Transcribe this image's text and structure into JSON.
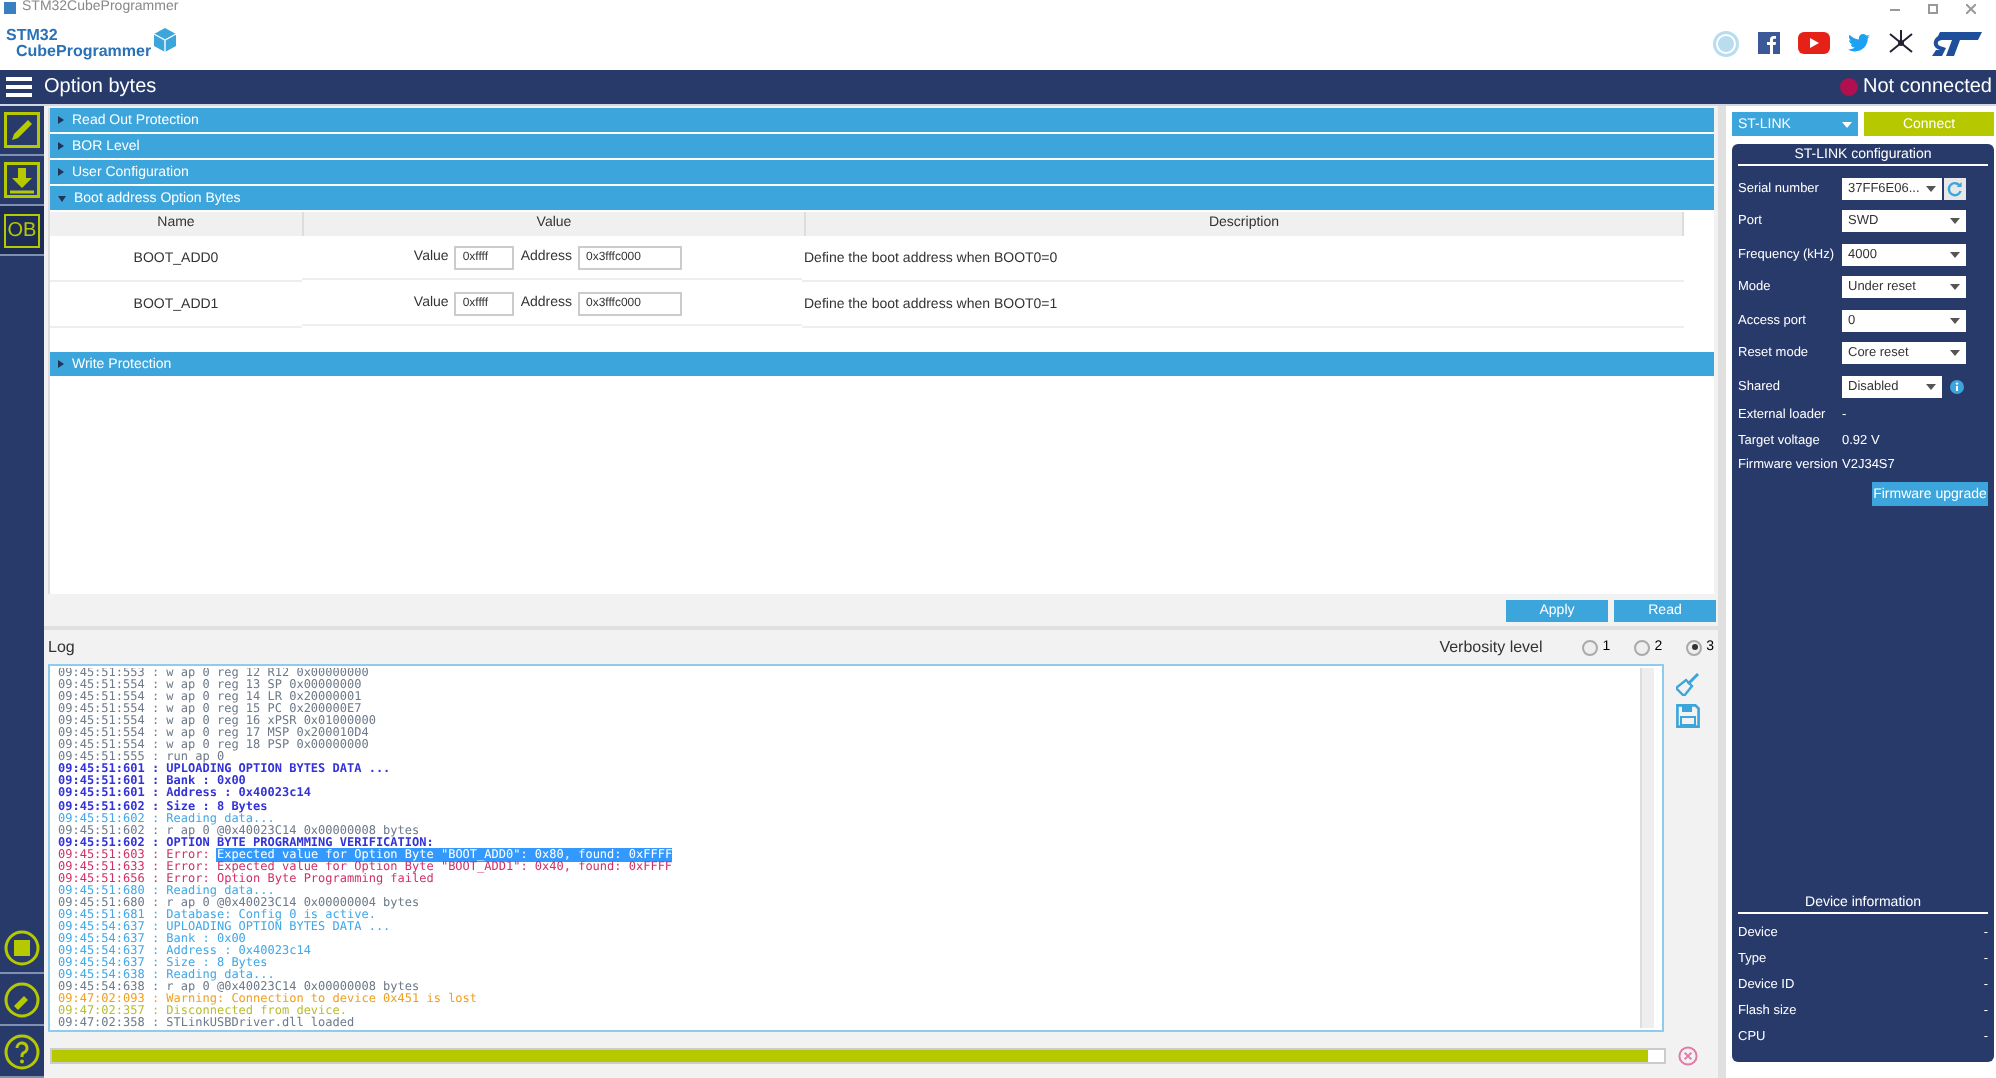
{
  "window": {
    "title": "STM32CubeProgrammer"
  },
  "logo": {
    "line_1": "STM32",
    "line_2": "CubeProgrammer"
  },
  "page_title": "Option bytes",
  "connection_status": {
    "text": "Not connected",
    "connected": false
  },
  "sidebar": {
    "items": [
      {
        "kind": "pencil",
        "selected": false
      },
      {
        "kind": "download",
        "selected": false
      },
      {
        "kind": "text",
        "label": "OB",
        "selected": true
      }
    ],
    "bottom_items": [
      {
        "kind": "chip"
      },
      {
        "kind": "plug"
      },
      {
        "kind": "help"
      }
    ]
  },
  "sections": [
    {
      "title": "Read Out Protection",
      "expanded": false
    },
    {
      "title": "BOR Level",
      "expanded": false
    },
    {
      "title": "User Configuration",
      "expanded": false
    },
    {
      "title": "Boot address Option Bytes",
      "expanded": true,
      "table": {
        "columns": [
          "Name",
          "Value",
          "Description"
        ],
        "rows": [
          {
            "name": "BOOT_ADD0",
            "value_label": "Value",
            "value": "0xffff",
            "address_label": "Address",
            "address": "0x3fffc000",
            "description": "Define the boot address when BOOT0=0"
          },
          {
            "name": "BOOT_ADD1",
            "value_label": "Value",
            "value": "0xffff",
            "address_label": "Address",
            "address": "0x3fffc000",
            "description": "Define the boot address when BOOT0=1"
          }
        ]
      }
    },
    {
      "title": "Write Protection",
      "expanded": false
    }
  ],
  "buttons": [
    "Apply",
    "Read"
  ],
  "log": {
    "title": "Log",
    "verbosity_label": "Verbosity level",
    "verbosity": [
      {
        "label": "1",
        "selected": false
      },
      {
        "label": "2",
        "selected": false
      },
      {
        "label": "3",
        "selected": true
      }
    ],
    "lines": [
      {
        "text": "09:45:51:553 : w ap 0 reg 12 R12 0x00000000",
        "kind": "normal"
      },
      {
        "text": "09:45:51:554 : w ap 0 reg 13 SP 0x00000000",
        "kind": "normal"
      },
      {
        "text": "09:45:51:554 : w ap 0 reg 14 LR 0x20000001",
        "kind": "normal"
      },
      {
        "text": "09:45:51:554 : w ap 0 reg 15 PC 0x200000E7",
        "kind": "normal"
      },
      {
        "text": "09:45:51:554 : w ap 0 reg 16 xPSR 0x01000000",
        "kind": "normal"
      },
      {
        "text": "09:45:51:554 : w ap 0 reg 17 MSP 0x200010D4",
        "kind": "normal"
      },
      {
        "text": "09:45:51:554 : w ap 0 reg 18 PSP 0x00000000",
        "kind": "normal"
      },
      {
        "text": "09:45:51:555 : run ap 0",
        "kind": "normal"
      },
      {
        "text": "09:45:51:601 : UPLOADING OPTION BYTES DATA ...",
        "kind": "title"
      },
      {
        "text": "09:45:51:601 : Bank : 0x00",
        "kind": "title"
      },
      {
        "text": "09:45:51:601 : Address : 0x40023c14",
        "kind": "title"
      },
      {
        "text": "09:45:51:602 : Size : 8 Bytes",
        "kind": "title"
      },
      {
        "text": "09:45:51:602 : Reading data...",
        "kind": "info"
      },
      {
        "text": "09:45:51:602 : r ap 0 @0x40023C14 0x00000008 bytes",
        "kind": "normal"
      },
      {
        "text": "09:45:51:602 : OPTION BYTE PROGRAMMING VERIFICATION:",
        "kind": "title"
      },
      {
        "text": "09:45:51:603 : Error: ",
        "selected_text": "Expected value for Option Byte \"BOOT_ADD0\": 0x80, found: 0xFFFF",
        "kind": "error"
      },
      {
        "text": "09:45:51:633 : Error: Expected value for Option Byte \"BOOT_ADD1\": 0x40, found: 0xFFFF",
        "kind": "error"
      },
      {
        "text": "09:45:51:656 : Error: Option Byte Programming failed",
        "kind": "error"
      },
      {
        "text": "09:45:51:680 : Reading data...",
        "kind": "info"
      },
      {
        "text": "09:45:51:680 : r ap 0 @0x40023C14 0x00000004 bytes",
        "kind": "normal"
      },
      {
        "text": "09:45:51:681 : Database: Config 0 is active.",
        "kind": "info"
      },
      {
        "text": "09:45:54:637 : UPLOADING OPTION BYTES DATA ...",
        "kind": "info"
      },
      {
        "text": "09:45:54:637 : Bank : 0x00",
        "kind": "info"
      },
      {
        "text": "09:45:54:637 : Address : 0x40023c14",
        "kind": "info"
      },
      {
        "text": "09:45:54:637 : Size : 8 Bytes",
        "kind": "info"
      },
      {
        "text": "09:45:54:638 : Reading data...",
        "kind": "info"
      },
      {
        "text": "09:45:54:638 : r ap 0 @0x40023C14 0x00000008 bytes",
        "kind": "normal"
      },
      {
        "text": "09:47:02:093 : Warning: Connection to device 0x451 is lost",
        "kind": "warning"
      },
      {
        "text": "09:47:02:357 : Disconnected from device.",
        "kind": "success"
      },
      {
        "text": "09:47:02:358 : STLinkUSBDriver.dll loaded",
        "kind": "normal"
      }
    ]
  },
  "progress": {
    "level": 0.99
  },
  "interface": {
    "selector": "ST-LINK",
    "connect_button": "Connect"
  },
  "config": {
    "title": "ST-LINK configuration",
    "fields": [
      {
        "label": "Serial number",
        "value": "37FF6E06...",
        "kind": "select_refresh"
      },
      {
        "label": "Port",
        "value": "SWD",
        "kind": "select"
      },
      {
        "label": "Frequency (kHz)",
        "value": "4000",
        "kind": "select"
      },
      {
        "label": "Mode",
        "value": "Under reset",
        "kind": "select"
      },
      {
        "label": "Access port",
        "value": "0",
        "kind": "select"
      },
      {
        "label": "Reset mode",
        "value": "Core reset",
        "kind": "select"
      },
      {
        "label": "Shared",
        "value": "Disabled",
        "kind": "select_info"
      },
      {
        "label": "External loader",
        "value": "-",
        "kind": "text"
      },
      {
        "label": "Target voltage",
        "value": "0.92 V",
        "kind": "text"
      },
      {
        "label": "Firmware version",
        "value": "V2J34S7",
        "kind": "text"
      }
    ],
    "firmware_button": "Firmware upgrade"
  },
  "device_info": {
    "title": "Device information",
    "fields": [
      {
        "label": "Device",
        "value": "-"
      },
      {
        "label": "Type",
        "value": "-"
      },
      {
        "label": "Device ID",
        "value": "-"
      },
      {
        "label": "Flash size",
        "value": "-"
      },
      {
        "label": "CPU",
        "value": "-"
      }
    ]
  }
}
